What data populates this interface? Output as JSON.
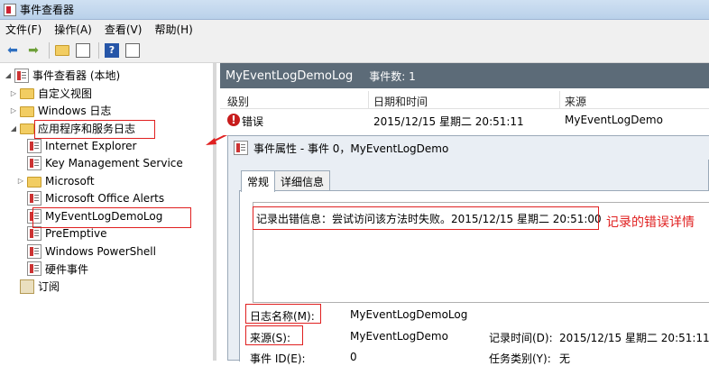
{
  "window": {
    "title": "事件查看器"
  },
  "menu": [
    "文件(F)",
    "操作(A)",
    "查看(V)",
    "帮助(H)"
  ],
  "toolbar": {
    "icons": [
      "back-arrow-icon",
      "forward-arrow-icon",
      "folder-up-icon",
      "console-tree-icon",
      "help-icon",
      "action-pane-icon"
    ],
    "help_label": "?"
  },
  "tree": {
    "root": "事件查看器 (本地)",
    "custom_views": "自定义视图",
    "windows_logs": "Windows 日志",
    "app_service_logs": "应用程序和服务日志",
    "children": [
      "Internet Explorer",
      "Key Management Service",
      "Microsoft",
      "Microsoft Office Alerts",
      "MyEventLogDemoLog",
      "PreEmptive",
      "Windows PowerShell",
      "硬件事件"
    ],
    "subscriptions": "订阅"
  },
  "panel": {
    "log_name": "MyEventLogDemoLog",
    "event_count": "事件数: 1"
  },
  "list": {
    "headers": {
      "level": "级别",
      "datetime": "日期和时间",
      "source": "来源"
    },
    "rows": [
      {
        "level": "错误",
        "datetime": "2015/12/15 星期二 20:51:11",
        "source": "MyEventLogDemo"
      }
    ],
    "error_glyph": "!"
  },
  "dialog": {
    "title": "事件属性 - 事件 0，MyEventLogDemo",
    "tabs": [
      "常规",
      "详细信息"
    ],
    "description": "记录出错信息：尝试访问该方法时失败。2015/12/15 星期二 20:51:00",
    "props": {
      "log_name_label": "日志名称(M):",
      "log_name_value": "MyEventLogDemoLog",
      "source_label": "来源(S):",
      "source_value": "MyEventLogDemo",
      "logged_label": "记录时间(D):",
      "logged_value": "2015/12/15 星期二 20:51:11",
      "event_id_label": "事件 ID(E):",
      "event_id_value": "0",
      "task_category_label": "任务类别(Y):",
      "task_category_value": "无"
    }
  },
  "annotation": "记录的错误详情",
  "colors": {
    "highlight_box": "#e02020",
    "panel_header": "#5c6b78",
    "error_icon": "#c71c1c"
  }
}
